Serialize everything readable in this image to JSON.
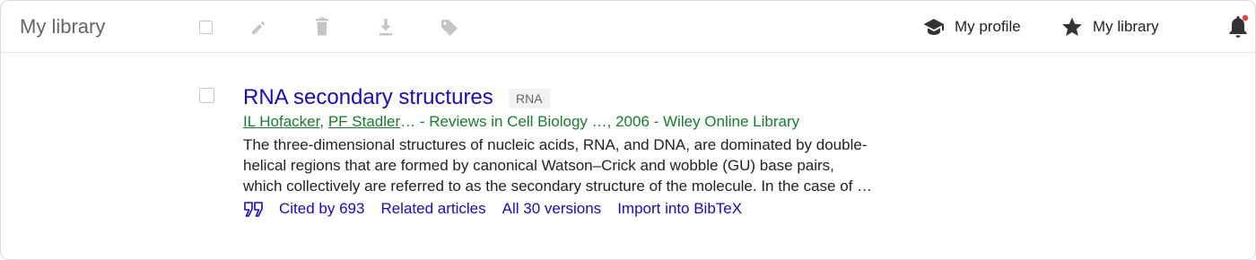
{
  "header": {
    "title": "My library",
    "toolbar_icons": [
      "checkbox",
      "pencil-icon",
      "trash-icon",
      "download-icon",
      "label-icon"
    ],
    "nav": {
      "profile_label": "My profile",
      "library_label": "My library"
    },
    "notification_badge_color": "#ea4335"
  },
  "result": {
    "title": "RNA secondary structures",
    "tag": "RNA",
    "authors": [
      "IL Hofacker",
      "PF Stadler"
    ],
    "author_sep": ", ",
    "meta_suffix": "… - Reviews in Cell Biology …, 2006 - Wiley Online Library",
    "snippet_lines": [
      "The three-dimensional structures of nucleic acids, RNA, and DNA, are dominated by double-",
      "helical regions that are formed by canonical Watson–Crick and wobble (GU) base pairs,",
      "which collectively are referred to as the secondary structure of the molecule. In the case of …"
    ],
    "actions": {
      "cited_by": "Cited by 693",
      "related": "Related articles",
      "versions": "All 30 versions",
      "import": "Import into BibTeX"
    }
  },
  "colors": {
    "link": "#1a0dab",
    "meta_green": "#1a7a2f",
    "icon_gray": "#c4c4c4",
    "dark_icon": "#333333"
  }
}
